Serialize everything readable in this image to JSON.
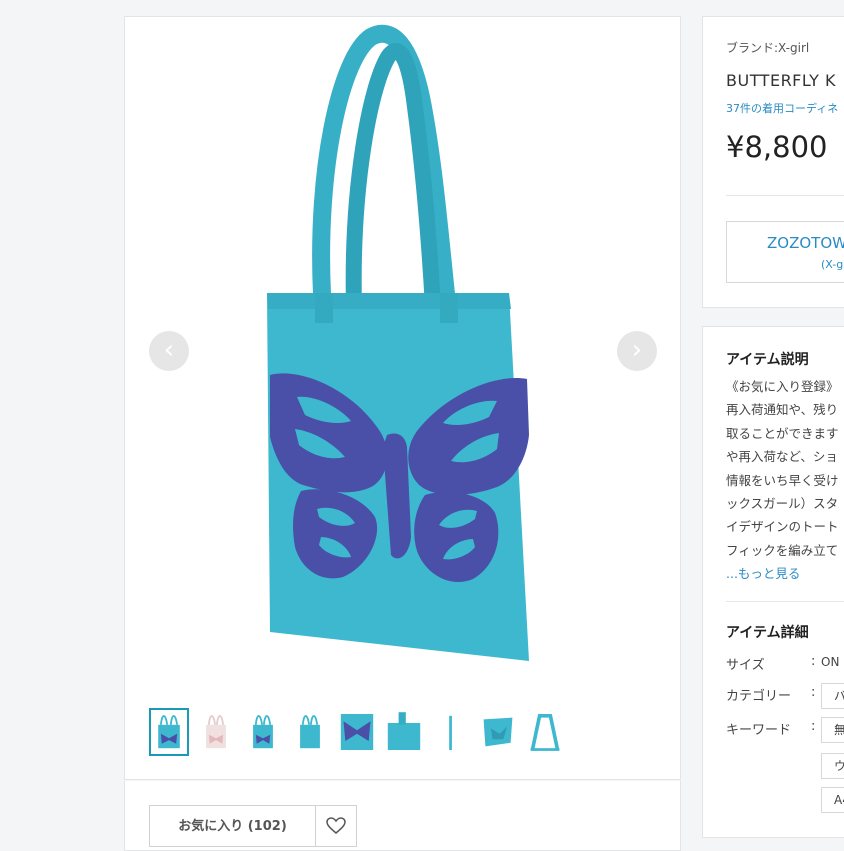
{
  "gallery": {
    "prev_arrow": "‹",
    "next_arrow": "›",
    "thumbnail_count": 9
  },
  "favorite": {
    "label": "お気に入り (102)",
    "heart_icon": "heart-outline"
  },
  "product": {
    "brand": "ブランド:X-girl",
    "name": "BUTTERFLY K",
    "coordinate_link": "37件の着用コーディネ",
    "price": "¥8,800",
    "shop_button_line1": "ZOZOTOW",
    "shop_button_line2": "(X-g"
  },
  "description": {
    "title": "アイテム説明",
    "lines": [
      "《お気に入り登録》",
      "再入荷通知や、残り",
      "取ることができます",
      "や再入荷など、ショ",
      "情報をいち早く受け",
      "ックスガール）スタ",
      "イデザインのトート",
      "フィックを編み立て"
    ],
    "more_link": "...もっと見る"
  },
  "details": {
    "title": "アイテム詳細",
    "size_label": "サイズ",
    "size_value": "ON",
    "category_label": "カテゴリー",
    "category_chip": "バ",
    "keyword_label": "キーワード",
    "keyword_chips": [
      "無",
      "ウ",
      "A4"
    ]
  },
  "colors": {
    "bag": "#3db8cf",
    "butterfly": "#4a4fa8",
    "link": "#2a8bc4",
    "selected_border": "#1a9bb5"
  }
}
